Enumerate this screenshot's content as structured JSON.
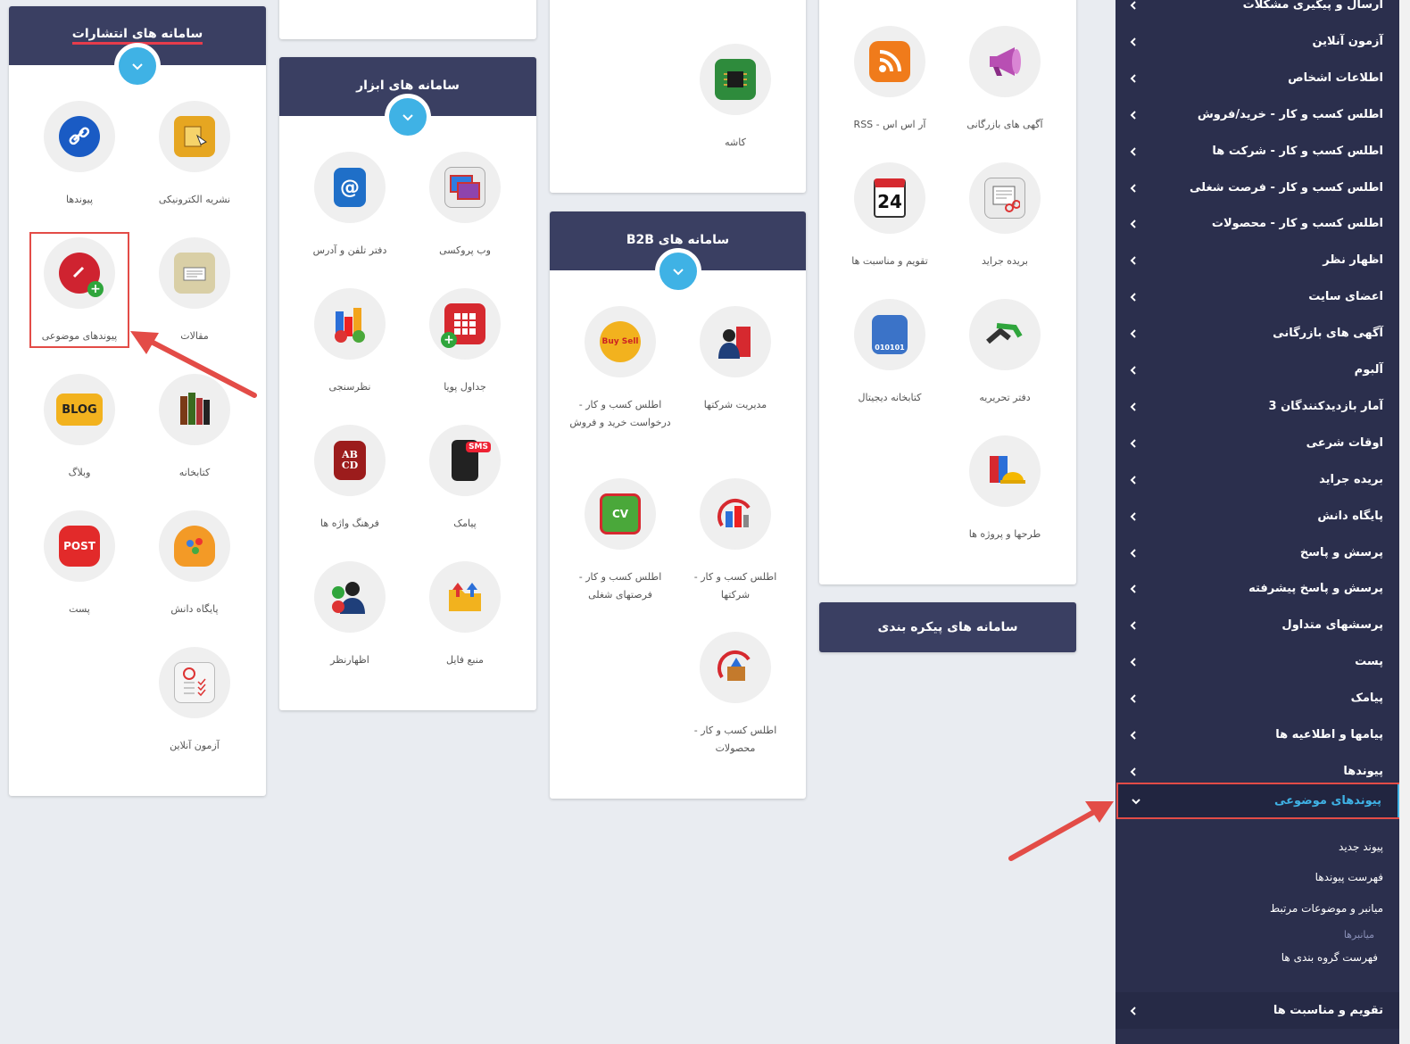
{
  "publications": {
    "title": "سامانه های انتشارات",
    "items": [
      {
        "label": "نشریه الکترونیکی",
        "icon": "newsletter-icon"
      },
      {
        "label": "پیوندها",
        "icon": "link-icon"
      },
      {
        "label": "مقالات",
        "icon": "articles-icon"
      },
      {
        "label": "پیوندهای موضوعی",
        "icon": "topic-links-icon"
      },
      {
        "label": "کتابخانه",
        "icon": "library-icon"
      },
      {
        "label": "وبلاگ",
        "icon": "blog-icon",
        "badge": "BLOG"
      },
      {
        "label": "پایگاه دانش",
        "icon": "knowledge-base-icon"
      },
      {
        "label": "پست",
        "icon": "post-icon",
        "badge": "POST"
      },
      {
        "label": "آزمون آنلاین",
        "icon": "online-exam-icon"
      }
    ]
  },
  "tools": {
    "title": "سامانه های ابزار",
    "items": [
      {
        "label": "وب پروکسی",
        "icon": "web-proxy-icon"
      },
      {
        "label": "دفتر تلفن و آدرس",
        "icon": "address-book-icon"
      },
      {
        "label": "جداول پویا",
        "icon": "dynamic-tables-icon"
      },
      {
        "label": "نظرسنجی",
        "icon": "poll-icon"
      },
      {
        "label": "پیامک",
        "icon": "sms-icon",
        "badge": "SMS"
      },
      {
        "label": "فرهنگ واژه ها",
        "icon": "dictionary-icon",
        "badge": "AB CD"
      },
      {
        "label": "منبع فایل",
        "icon": "file-source-icon"
      },
      {
        "label": "اظهارنظر",
        "icon": "comment-icon"
      }
    ]
  },
  "col3_top": {
    "items": [
      {
        "label": "کاشه",
        "icon": "cache-chip-icon"
      }
    ]
  },
  "b2b": {
    "title": "سامانه های B2B",
    "items": [
      {
        "label": "مدیریت شرکتها",
        "icon": "company-management-icon"
      },
      {
        "label": "اطلس کسب و کار - درخواست خرید و فروش",
        "icon": "buy-sell-icon",
        "badge": "Buy Sell"
      },
      {
        "label": "اطلس کسب و کار - شرکتها",
        "icon": "atlas-companies-icon"
      },
      {
        "label": "اطلس کسب و کار - فرصتهای شغلی",
        "icon": "atlas-jobs-icon",
        "badge": "CV"
      },
      {
        "label": "اطلس کسب و کار - محصولات",
        "icon": "atlas-products-icon"
      }
    ]
  },
  "col4": {
    "items": [
      {
        "label": "آگهی های بازرگانی",
        "icon": "megaphone-icon"
      },
      {
        "label": "آر اس اس - RSS",
        "icon": "rss-icon"
      },
      {
        "label": "بریده جراید",
        "icon": "newspaper-clip-icon"
      },
      {
        "label": "تقویم و مناسبت ها",
        "icon": "calendar-icon",
        "badge": "24"
      },
      {
        "label": "دفتر تحریریه",
        "icon": "editorial-icon"
      },
      {
        "label": "کتابخانه دیجیتال",
        "icon": "digital-library-icon",
        "badge": "010101"
      },
      {
        "label": "طرحها و پروژه ها",
        "icon": "projects-icon"
      }
    ]
  },
  "config": {
    "title": "سامانه های پیکره بندی"
  },
  "sidebar": {
    "items": [
      "ارسال و پیگیری مشکلات",
      "آزمون آنلاین",
      "اطلاعات اشخاص",
      "اطلس کسب و کار - خرید/فروش",
      "اطلس کسب و کار - شرکت ها",
      "اطلس کسب و کار - فرصت شغلی",
      "اطلس کسب و کار - محصولات",
      "اظهار نظر",
      "اعضای سایت",
      "آگهی های بازرگانی",
      "آلبوم",
      "آمار بازدیدکنندگان 3",
      "اوقات شرعی",
      "بریده جراید",
      "پایگاه دانش",
      "پرسش و پاسخ",
      "پرسش و پاسخ پیشرفته",
      "پرسشهای متداول",
      "پست",
      "پیامک",
      "پیامها و اطلاعیه ها",
      "پیوندها"
    ],
    "active": "پیوندهای موضوعی",
    "sub": [
      "پیوند جدید",
      "فهرست پیوندها",
      "میانبر و موضوعات مرتبط"
    ],
    "sub_muted": "میانبرها",
    "sub_last": "فهرست گروه بندی ها",
    "bottom": "تقویم و مناسبت ها"
  },
  "colors": {
    "header": "#3a3f62",
    "accent_blue": "#3fb2e5",
    "highlight_red": "#e34c47",
    "sidebar": "#2b2f4d"
  }
}
